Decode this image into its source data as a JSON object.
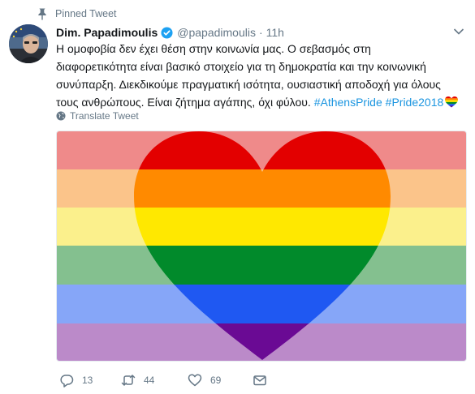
{
  "pinned": {
    "label": "Pinned Tweet",
    "icon": "pin-icon"
  },
  "author": {
    "display_name": "Dim. Papadimoulis",
    "handle": "@papadimoulis",
    "separator": "·",
    "time": "11h",
    "verified_icon": "verified-badge-icon",
    "verified_color": "#1da1f2"
  },
  "tweet": {
    "lines": [
      "Η ομοφοβία δεν έχει θέση στην κοινωνία μας. Ο σεβασμός στη",
      "διαφορετικότητα είναι βασικό στοιχείο για τη δημοκρατία και την κοινωνική",
      "συνύπαρξη. Διεκδικούμε πραγματική ισότητα, ουσιαστική αποδοχή για όλους"
    ],
    "last_line_text": "τους ανθρώπους. Είναι ζήτημα αγάπης, όχι φύλου. ",
    "hashtag_1": "#AthensPride",
    "hashtag_2": "#Pride2018",
    "emoji": "rainbow-heart-icon"
  },
  "translate": {
    "label": "Translate Tweet",
    "icon": "globe-icon"
  },
  "media": {
    "description_icon": "rainbow-heart-flag-image",
    "stripe_colors": [
      "#ef8a8a",
      "#fbc48a",
      "#fbf08c",
      "#84c08f",
      "#86a6f8",
      "#bb8ac9"
    ],
    "heart_colors": [
      "#e30000",
      "#ff8a00",
      "#ffe800",
      "#018a2b",
      "#1f58f2",
      "#6a0a94"
    ]
  },
  "actions": {
    "reply_count": "13",
    "retweet_count": "44",
    "like_count": "69"
  },
  "colors": {
    "accent": "#1b95e0",
    "muted": "#657786",
    "text": "#14171a"
  }
}
